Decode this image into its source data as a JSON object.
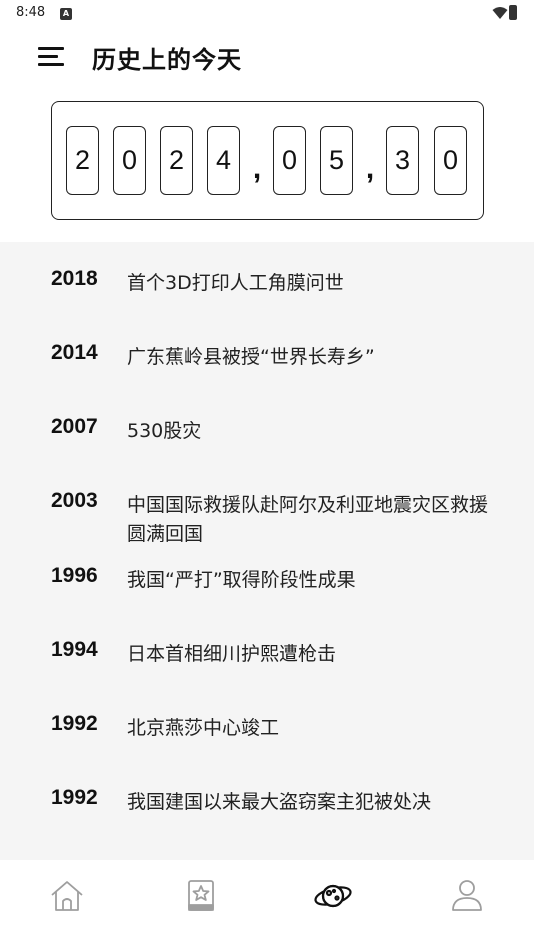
{
  "status_bar": {
    "time": "8:48",
    "notification_icon": "a-badge-icon",
    "wifi_icon": "wifi-icon",
    "battery_icon": "battery-icon"
  },
  "header": {
    "menu_icon": "menu-icon",
    "title": "历史上的今天"
  },
  "date": {
    "digits": [
      "2",
      "0",
      "2",
      "4",
      "0",
      "5",
      "3",
      "0"
    ],
    "separators": [
      ",",
      ","
    ]
  },
  "events": [
    {
      "year": "2018",
      "text": "首个3D打印人工角膜问世"
    },
    {
      "year": "2014",
      "text": "广东蕉岭县被授“世界长寿乡”"
    },
    {
      "year": "2007",
      "text": "530股灾"
    },
    {
      "year": "2003",
      "text": "中国国际救援队赴阿尔及利亚地震灾区救援圆满回国"
    },
    {
      "year": "1996",
      "text": "我国“严打”取得阶段性成果"
    },
    {
      "year": "1994",
      "text": "日本首相细川护熙遭枪击"
    },
    {
      "year": "1992",
      "text": "北京燕莎中心竣工"
    },
    {
      "year": "1992",
      "text": "我国建国以来最大盗窃案主犯被处决"
    }
  ],
  "bottom_nav": {
    "items": [
      {
        "icon": "home-icon"
      },
      {
        "icon": "star-book-icon"
      },
      {
        "icon": "planet-icon",
        "active": true
      },
      {
        "icon": "user-icon"
      }
    ]
  },
  "colors": {
    "text": "#111111",
    "list_background": "#f5f5f5",
    "background": "#ffffff",
    "icon_gray": "#9e9e9e"
  }
}
